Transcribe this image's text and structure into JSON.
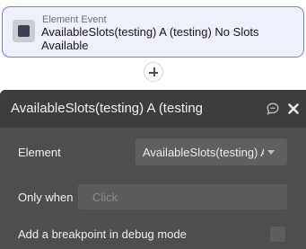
{
  "event": {
    "kind": "Element Event",
    "title": "AvailableSlots(testing) A (testing) No Slots Available"
  },
  "panel": {
    "title": "AvailableSlots(testing) A (testing",
    "element_label": "Element",
    "element_value": "AvailableSlots(testing) A",
    "only_when_label": "Only when",
    "only_when_placeholder": "Click",
    "debug_label": "Add a breakpoint in debug mode",
    "debug_checked": false
  },
  "icons": {
    "event": "element-event-icon",
    "add": "plus-icon",
    "comment": "comment-icon",
    "close": "close-icon",
    "caret": "chevron-down-icon"
  },
  "colors": {
    "card_border": "#6f82de",
    "card_bg": "#eef1fb",
    "panel_bg": "#4e4e4e",
    "panel_header_bg": "#3d3d3d"
  }
}
